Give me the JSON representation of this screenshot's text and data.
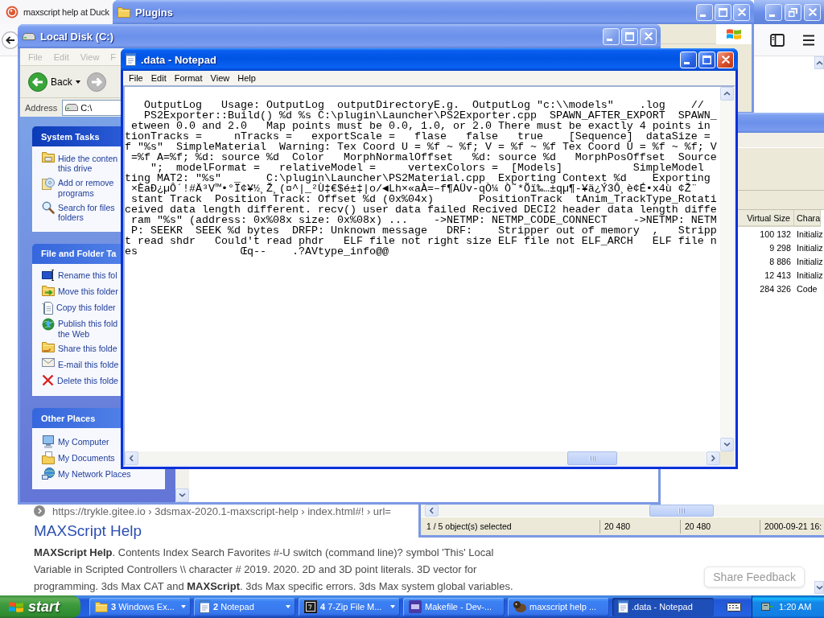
{
  "browser": {
    "active": false,
    "tab": {
      "title": "maxscript help at Duck"
    },
    "result": {
      "url": "https://trykle.gitee.io › 3dsmax-2020.1-maxscript-help › index.html#! › url=",
      "title": "MAXScript Help",
      "snippet": [
        "**MAXScript Help**. Contents Index Search Favorites #-U switch (command line)? symbol 'This' Local",
        "Variable in Scripted Controllers \\\\ character # 2019. 2020. 2D and 3D point literals. 3D vector for",
        "programming. 3ds Max CAT and **MAXScript**. 3ds Max specific errors. 3ds Max system global variables."
      ]
    },
    "feedback_button": "Share Feedback"
  },
  "folder_window": {
    "title": "Plugins",
    "active": false
  },
  "file_manager": {
    "active": false,
    "columns": [
      "Virtual Size",
      "Chara"
    ],
    "rows": [
      [
        "100 132",
        "Initializ"
      ],
      [
        "9 298",
        "Initializ"
      ],
      [
        "8 886",
        "Initializ"
      ],
      [
        "12 413",
        "Initializ"
      ],
      [
        "284 326",
        "Code"
      ]
    ],
    "status": [
      "1 / 5 object(s) selected",
      "20 480",
      "20 480",
      "2000-09-21 16:"
    ]
  },
  "explorer": {
    "title": "Local Disk (C:)",
    "active": false,
    "menu": [
      "File",
      "Edit",
      "View",
      "F"
    ],
    "back": {
      "label": "Back",
      "disabled": false
    },
    "forward": {
      "disabled": true
    },
    "address_label": "Address",
    "address": "C:\\",
    "task_panels": [
      {
        "title": "System Tasks",
        "items": [
          [
            "Hide the conten",
            "this drive"
          ],
          [
            "Add or remove",
            "programs"
          ],
          [
            "Search for files",
            "folders"
          ]
        ]
      },
      {
        "title": "File and Folder Ta",
        "items": [
          [
            "Rename this fol"
          ],
          [
            "Move this folder"
          ],
          [
            "Copy this folder"
          ],
          [
            "Publish this fold",
            "the Web"
          ],
          [
            "Share this folde"
          ],
          [
            "E-mail this folde"
          ],
          [
            "Delete this folde"
          ]
        ]
      },
      {
        "title": "Other Places",
        "items": [
          [
            "My Computer"
          ],
          [
            "My Documents"
          ],
          [
            "My Network Places"
          ]
        ]
      }
    ]
  },
  "notepad": {
    "title": ".data - Notepad",
    "active": true,
    "menu": [
      "File",
      "Edit",
      "Format",
      "View",
      "Help"
    ],
    "lines": [
      "   OutputLog   Usage: OutputLog  outputDirectoryE.g.  OutputLog \"c:\\\\models\"    .log    //",
      "   PS2Exporter::Build() %d %s C:\\plugin\\Launcher\\PS2Exporter.cpp  SPAWN_AFTER_EXPORT  SPAWN_",
      " etween 0.0 and 2.0   Map points must be 0.0, 1.0, or 2.0 There must be exactly 4 points in",
      "tionTracks =     nTracks =   exportScale =   flase   false   true    [Sequence]  dataSize =",
      "f \"%s\"  SimpleMaterial  Warning: Tex Coord U = %f ~ %f; V = %f ~ %f Tex Coord U = %f ~ %f; V",
      " =%f A=%f; %d: source %d  Color   MorphNormalOffset   %d: source %d   MorphPosOffset  Source",
      "    \";  modelFormat =   relativeModel =     vertexColors =  [Models]           SimpleModel",
      "ting MAT2: \"%s\"  _    C:\\plugin\\Launcher\\PS2Material.cpp  Exporting Context %d    Exporting",
      " ×ÈaÐ¿µÔ´!#Ä³V™•°Ï¢¥½¸Ž¸(¤^|_²Ù‡€$é±‡|o/◄Lh×«aÀ=–f¶AÜv-qÒ¼ Ò˜*Õï‰…±qµ¶-¥ä¿Ý3Ô¸è¢É•x4ù ¢Ž¨",
      " stant Track  Position Track: Offset %d (0x%04x)       PositionTrack  tAnim_TrackType_Rotati",
      "ceived data length different. recv() user data failed Recived DECI2 header data length diffe",
      " ram \"%s\" (address: 0x%08x size: 0x%08x) ...    ->NETMP: NETMP_CODE_CONNECT    ->NETMP: NETM",
      " P: SEEKR  SEEK %d bytes  DRFP: Unknown message   DRF:    Stripper out of memory  ,   Stripp",
      "t read shdr   Could't read phdr   ELF file not right size ELF file not ELF_ARCH   ELF file n",
      "es                Œq--    .?AVtype_info@@"
    ]
  },
  "taskbar": {
    "start": "start",
    "tasks": [
      {
        "count": "3",
        "label": "Windows Ex...",
        "selected": false
      },
      {
        "count": "2",
        "label": "Notepad",
        "selected": false
      },
      {
        "count": "4",
        "label": "7-Zip File M...",
        "selected": false
      },
      {
        "label": "Makefile - Dev-...",
        "selected": false
      },
      {
        "label": "maxscript help ...",
        "selected": false
      },
      {
        "label": ".data - Notepad",
        "selected": true
      }
    ],
    "clock": "1:20 AM"
  }
}
